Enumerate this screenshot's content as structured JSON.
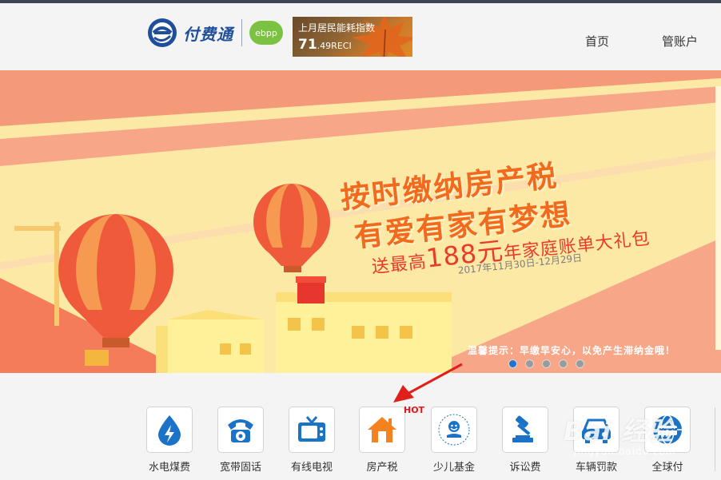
{
  "header": {
    "logo_text": "付费通",
    "ebpp_text": "ebpp",
    "index_label": "上月居民能耗指数",
    "index_value_int": "71",
    "index_value_dec": ".49",
    "index_unit": "RECI",
    "nav": [
      {
        "label": "首页"
      },
      {
        "label": "管账户"
      }
    ]
  },
  "banner": {
    "headline1": "按时缴纳房产税",
    "headline2": "有爱有家有梦想",
    "promo_pre": "送最高",
    "promo_amount": "188元",
    "promo_post": "年家庭账单大礼包",
    "date_range": "2017年11月30日-12月29日",
    "tip": "温馨提示：早缴早安心，以免产生滞纳金哦！",
    "slides": 5,
    "active_slide": 1
  },
  "services": {
    "hot_label": "HOT",
    "items": [
      {
        "label": "水电煤费",
        "icon": "water-drop-icon"
      },
      {
        "label": "宽带固话",
        "icon": "telephone-icon"
      },
      {
        "label": "有线电视",
        "icon": "tv-icon"
      },
      {
        "label": "房产税",
        "icon": "house-icon"
      },
      {
        "label": "少儿基金",
        "icon": "child-fund-icon"
      },
      {
        "label": "诉讼费",
        "icon": "gavel-icon"
      },
      {
        "label": "车辆罚款",
        "icon": "car-icon"
      },
      {
        "label": "全球付",
        "icon": "globe-card-icon"
      }
    ]
  },
  "watermark": {
    "main": "Bai 经验",
    "sub": "jingyan.baidu.com"
  },
  "colors": {
    "brand_blue": "#1f4f9a",
    "accent_orange": "#f26a1d",
    "hot_red": "#e8161b",
    "ebpp_green": "#7cc242"
  }
}
